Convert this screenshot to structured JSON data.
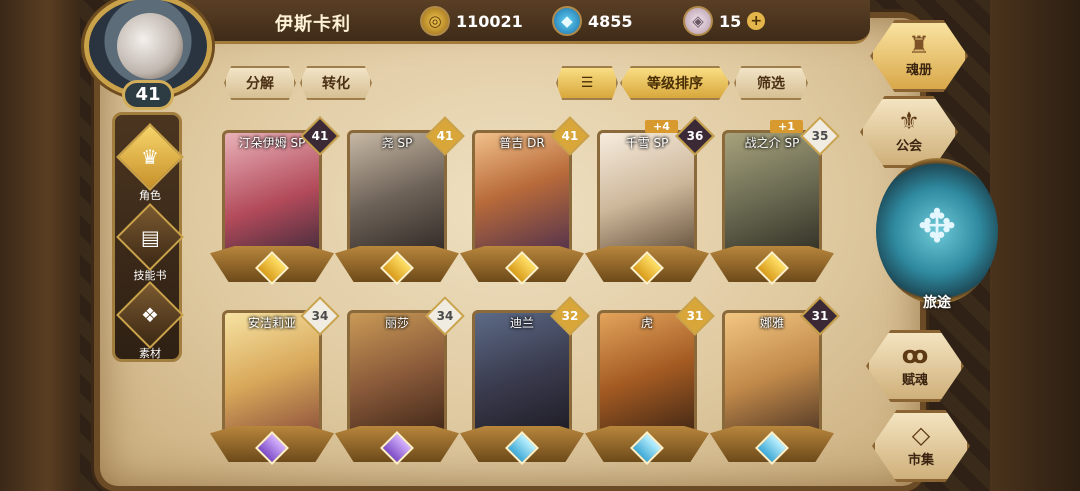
{
  "player": {
    "name": "伊斯卡利",
    "level": "41"
  },
  "resources": {
    "gold": "110021",
    "gems": "4855",
    "crystals": "15"
  },
  "left_nav": [
    {
      "label": "角色",
      "icon": "helmet-icon"
    },
    {
      "label": "技能书",
      "icon": "book-icon"
    },
    {
      "label": "素材",
      "icon": "material-icon"
    }
  ],
  "toolbar": {
    "decompose": "分解",
    "convert": "转化",
    "sort_icon": "sort-icon",
    "sort_by_level": "等级排序",
    "filter": "筛选"
  },
  "cards": [
    {
      "name": "汀朵伊姆 SP",
      "level": "41",
      "plus": ""
    },
    {
      "name": "尧 SP",
      "level": "41",
      "plus": ""
    },
    {
      "name": "普吉 DR",
      "level": "41",
      "plus": ""
    },
    {
      "name": "千雪 SP",
      "level": "36",
      "plus": "+4"
    },
    {
      "name": "战之介 SP",
      "level": "35",
      "plus": "+1"
    },
    {
      "name": "安洁莉亚",
      "level": "34",
      "plus": ""
    },
    {
      "name": "丽莎",
      "level": "34",
      "plus": ""
    },
    {
      "name": "迪兰",
      "level": "32",
      "plus": ""
    },
    {
      "name": "虎",
      "level": "31",
      "plus": ""
    },
    {
      "name": "娜雅",
      "level": "31",
      "plus": ""
    }
  ],
  "right_nav": {
    "soul_book": "魂册",
    "guild": "公会",
    "journey": "旅途",
    "talent": "赋魂",
    "market": "市集"
  }
}
